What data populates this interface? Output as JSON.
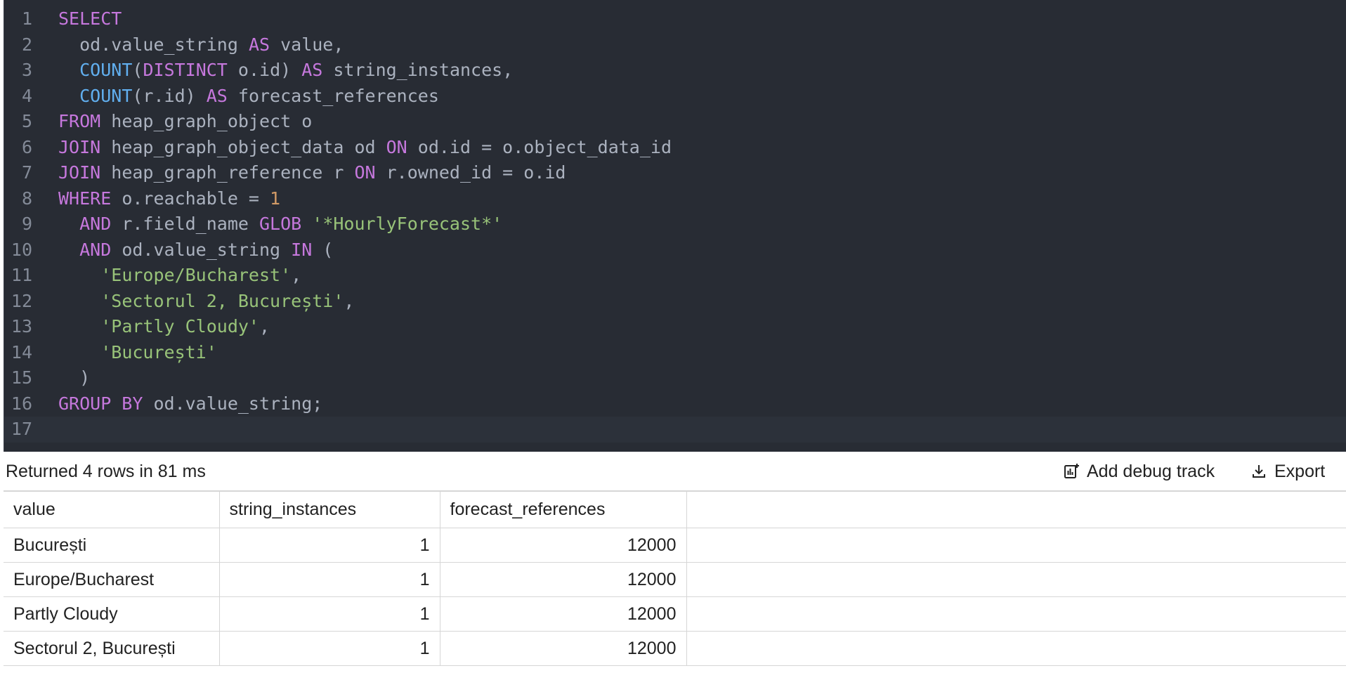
{
  "editor": {
    "line_numbers": [
      "1",
      "2",
      "3",
      "4",
      "5",
      "6",
      "7",
      "8",
      "9",
      "10",
      "11",
      "12",
      "13",
      "14",
      "15",
      "16",
      "17"
    ],
    "lines": [
      [
        [
          "kw",
          "SELECT"
        ]
      ],
      [
        [
          "",
          "  od.value_string "
        ],
        [
          "kw",
          "AS"
        ],
        [
          "",
          " value,"
        ]
      ],
      [
        [
          "",
          "  "
        ],
        [
          "fn",
          "COUNT"
        ],
        [
          "",
          "("
        ],
        [
          "kw",
          "DISTINCT"
        ],
        [
          "",
          " o.id) "
        ],
        [
          "kw",
          "AS"
        ],
        [
          "",
          " string_instances,"
        ]
      ],
      [
        [
          "",
          "  "
        ],
        [
          "fn",
          "COUNT"
        ],
        [
          "",
          "(r.id) "
        ],
        [
          "kw",
          "AS"
        ],
        [
          "",
          " forecast_references"
        ]
      ],
      [
        [
          "kw",
          "FROM"
        ],
        [
          "",
          " heap_graph_object o"
        ]
      ],
      [
        [
          "kw",
          "JOIN"
        ],
        [
          "",
          " heap_graph_object_data od "
        ],
        [
          "kw",
          "ON"
        ],
        [
          "",
          " od.id = o.object_data_id"
        ]
      ],
      [
        [
          "kw",
          "JOIN"
        ],
        [
          "",
          " heap_graph_reference r "
        ],
        [
          "kw",
          "ON"
        ],
        [
          "",
          " r.owned_id = o.id"
        ]
      ],
      [
        [
          "kw",
          "WHERE"
        ],
        [
          "",
          " o.reachable = "
        ],
        [
          "num",
          "1"
        ]
      ],
      [
        [
          "",
          "  "
        ],
        [
          "kw",
          "AND"
        ],
        [
          "",
          " r.field_name "
        ],
        [
          "kw",
          "GLOB"
        ],
        [
          "",
          " "
        ],
        [
          "str",
          "'*HourlyForecast*'"
        ]
      ],
      [
        [
          "",
          "  "
        ],
        [
          "kw",
          "AND"
        ],
        [
          "",
          " od.value_string "
        ],
        [
          "kw",
          "IN"
        ],
        [
          "",
          " ("
        ]
      ],
      [
        [
          "",
          "    "
        ],
        [
          "str",
          "'Europe/Bucharest'"
        ],
        [
          "",
          ","
        ]
      ],
      [
        [
          "",
          "    "
        ],
        [
          "str",
          "'Sectorul 2, București'"
        ],
        [
          "",
          ","
        ]
      ],
      [
        [
          "",
          "    "
        ],
        [
          "str",
          "'Partly Cloudy'"
        ],
        [
          "",
          ","
        ]
      ],
      [
        [
          "",
          "    "
        ],
        [
          "str",
          "'București'"
        ]
      ],
      [
        [
          "",
          "  )"
        ]
      ],
      [
        [
          "kw",
          "GROUP BY"
        ],
        [
          "",
          " od.value_string;"
        ]
      ],
      []
    ],
    "active_line": 17
  },
  "results": {
    "status": "Returned 4 rows in 81 ms",
    "add_debug_track_label": "Add debug track",
    "export_label": "Export",
    "columns": [
      "value",
      "string_instances",
      "forecast_references"
    ],
    "rows": [
      [
        "București",
        "1",
        "12000"
      ],
      [
        "Europe/Bucharest",
        "1",
        "12000"
      ],
      [
        "Partly Cloudy",
        "1",
        "12000"
      ],
      [
        "Sectorul 2, București",
        "1",
        "12000"
      ]
    ]
  }
}
